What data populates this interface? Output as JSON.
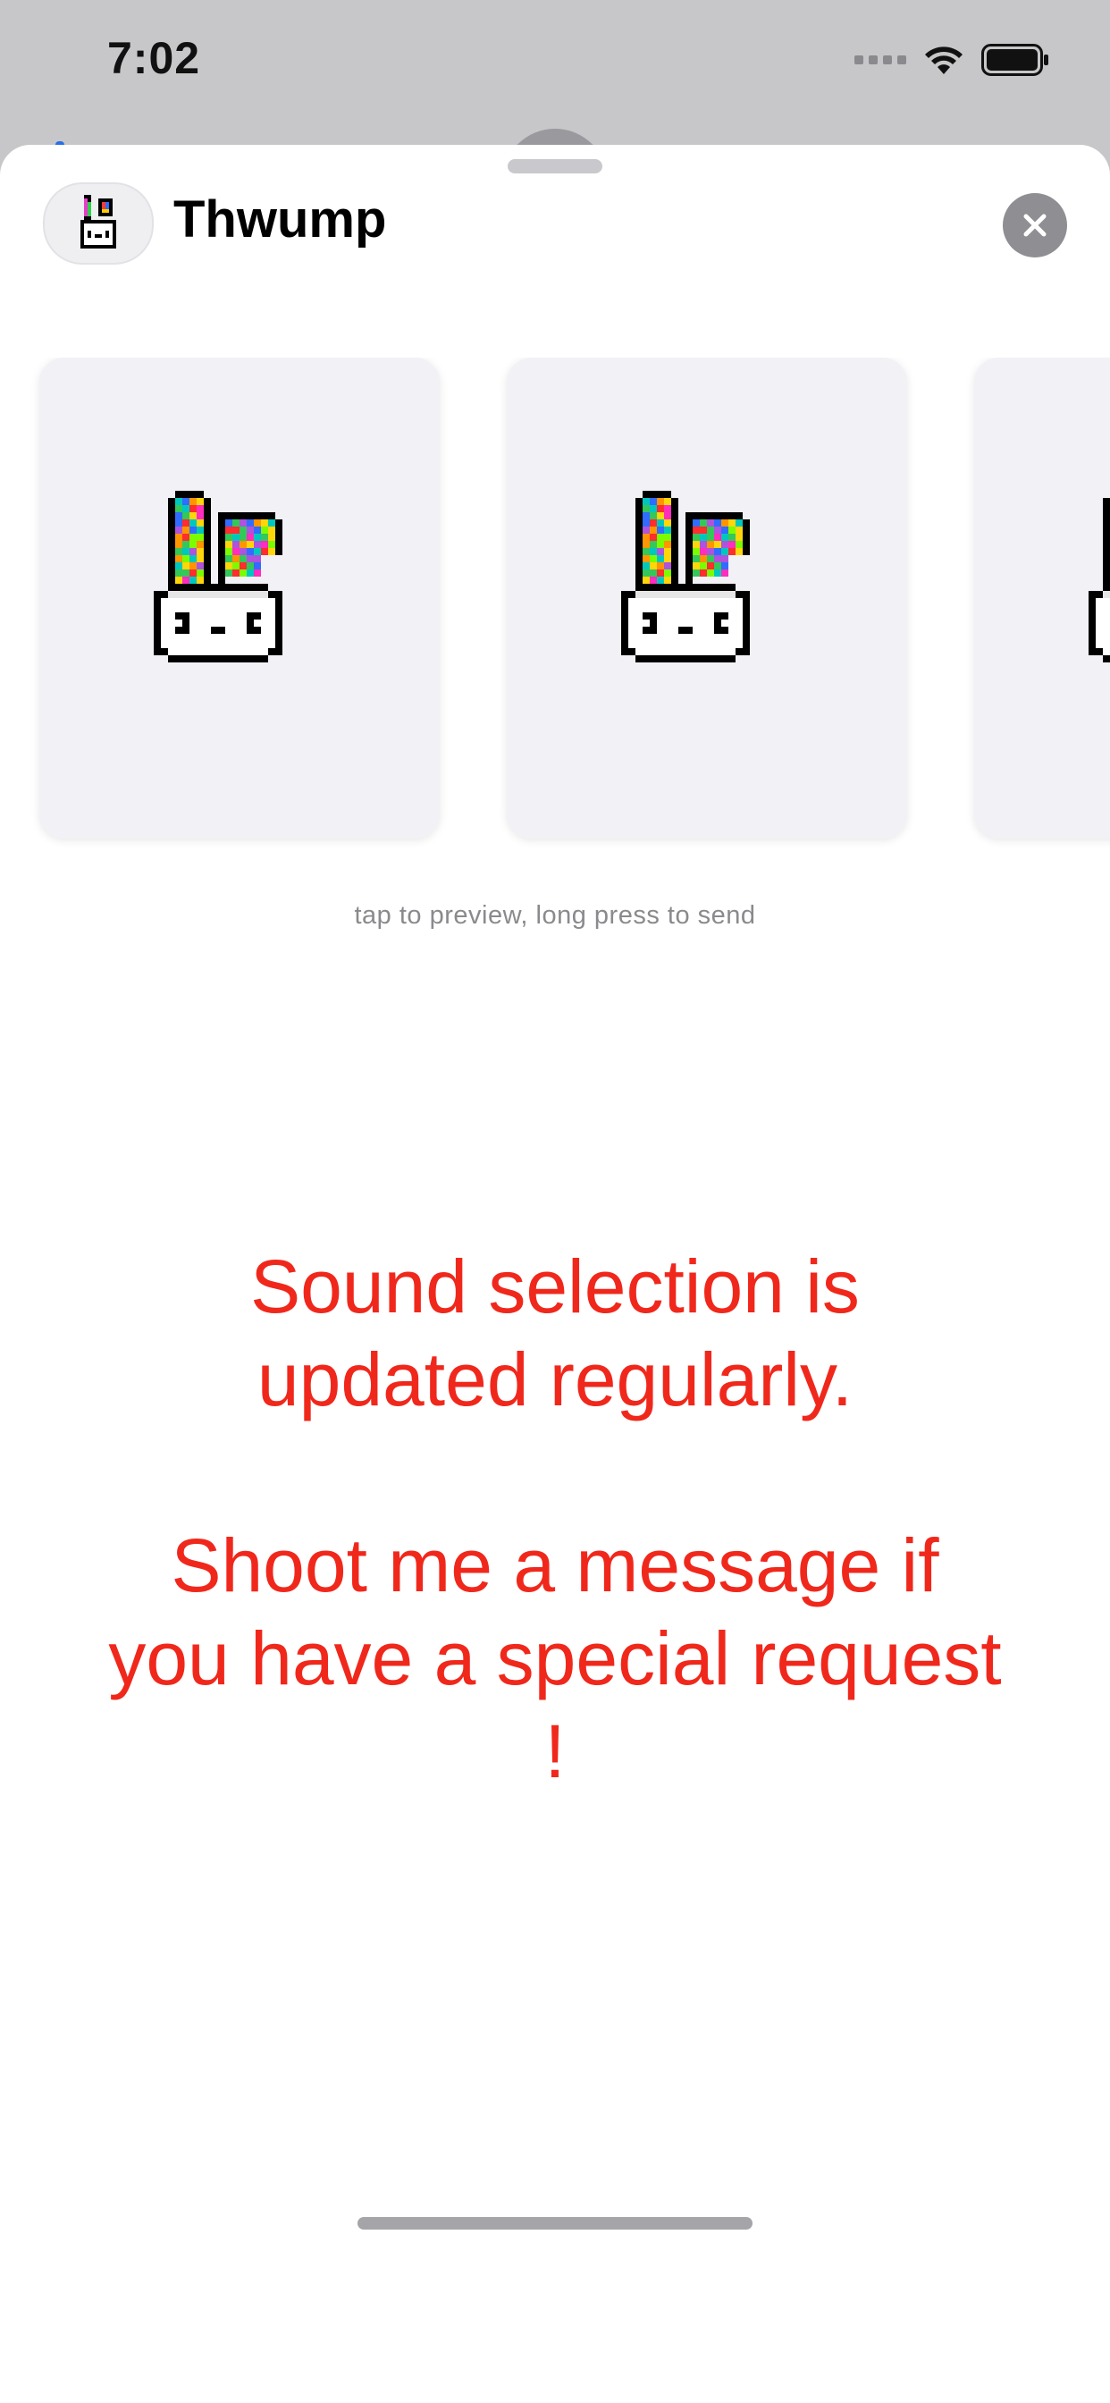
{
  "status_bar": {
    "time": "7:02"
  },
  "header": {
    "app_name": "Thwump",
    "icon": "bunny-icon",
    "close_icon": "close-icon"
  },
  "sounds": [
    {
      "icon": "rainbow-bunny-icon"
    },
    {
      "icon": "rainbow-bunny-icon"
    },
    {
      "icon": "rainbow-bunny-icon"
    }
  ],
  "hint": "tap to preview, long press to send",
  "notice": {
    "line1": "Sound selection is updated regularly.",
    "line2": "Shoot me a message if you have a special request !"
  },
  "colors": {
    "notice_text": "#f0281c",
    "sheet_background": "#ffffff",
    "card_background": "#f2f2f6"
  }
}
